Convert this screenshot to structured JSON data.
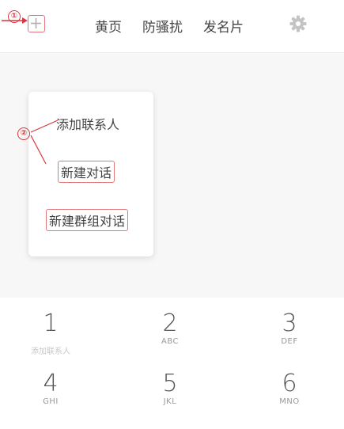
{
  "header": {
    "tabs": [
      {
        "label": "黄页"
      },
      {
        "label": "防骚扰"
      },
      {
        "label": "发名片"
      }
    ]
  },
  "annotations": {
    "step1": "①",
    "step2": "②"
  },
  "menu": {
    "items": [
      {
        "label": "添加联系人"
      },
      {
        "label": "新建对话"
      },
      {
        "label": "新建群组对话"
      }
    ]
  },
  "dialpad": {
    "keys": [
      {
        "digit": "1",
        "letters": "",
        "sub": "添加联系人"
      },
      {
        "digit": "2",
        "letters": "ABC"
      },
      {
        "digit": "3",
        "letters": "DEF"
      },
      {
        "digit": "4",
        "letters": "GHI"
      },
      {
        "digit": "5",
        "letters": "JKL"
      },
      {
        "digit": "6",
        "letters": "MNO"
      }
    ]
  },
  "colors": {
    "annotation_red": "#d9363e",
    "highlight_border": "#e0787a",
    "background": "#f7f7f7",
    "text": "#444444"
  },
  "icons": {
    "add": "plus-icon",
    "settings": "gear-icon"
  }
}
